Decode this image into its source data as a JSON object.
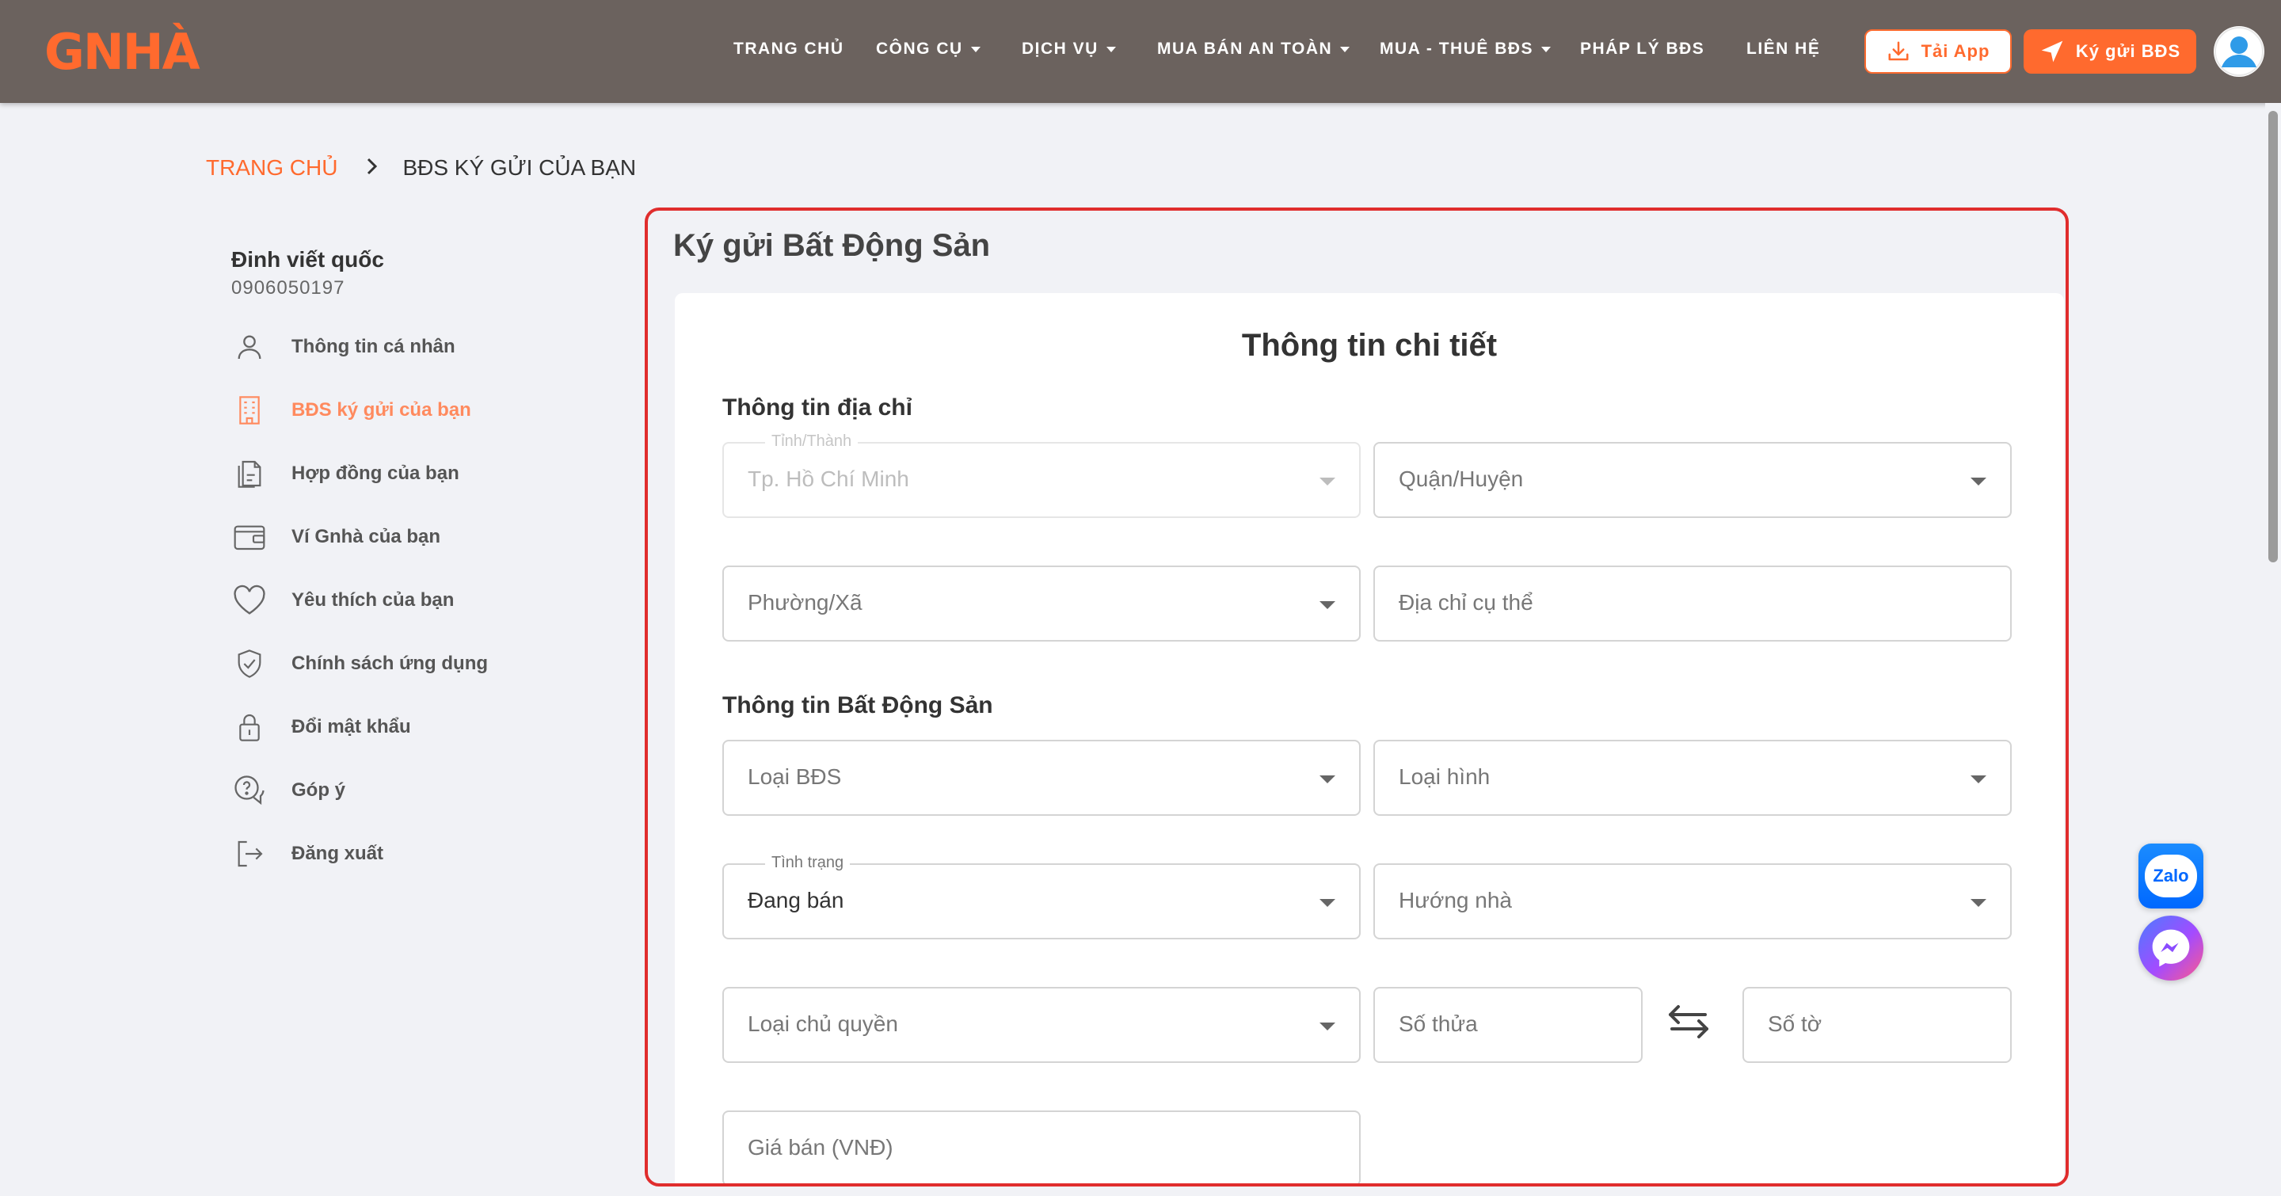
{
  "header": {
    "logo_text": "GNHÀ",
    "nav": [
      {
        "label": "TRANG CHỦ",
        "dropdown": false
      },
      {
        "label": "CÔNG CỤ",
        "dropdown": true
      },
      {
        "label": "DỊCH VỤ",
        "dropdown": true
      },
      {
        "label": "MUA BÁN AN TOÀN",
        "dropdown": true
      },
      {
        "label": "MUA - THUÊ BĐS",
        "dropdown": true
      },
      {
        "label": "PHÁP LÝ BĐS",
        "dropdown": false
      },
      {
        "label": "LIÊN HỆ",
        "dropdown": false
      }
    ],
    "app_button": "Tải App",
    "consign_button": "Ký gửi BĐS"
  },
  "breadcrumb": {
    "home": "TRANG CHỦ",
    "current": "BĐS KÝ GỬI CỦA BẠN"
  },
  "user": {
    "name": "Đinh viết quốc",
    "phone": "0906050197"
  },
  "sidebar": {
    "items": [
      {
        "label": "Thông tin cá nhân",
        "icon": "user-icon",
        "active": false
      },
      {
        "label": "BĐS ký gửi của bạn",
        "icon": "building-icon",
        "active": true
      },
      {
        "label": "Hợp đồng của bạn",
        "icon": "contract-icon",
        "active": false
      },
      {
        "label": "Ví Gnhà của bạn",
        "icon": "wallet-icon",
        "active": false
      },
      {
        "label": "Yêu thích của bạn",
        "icon": "heart-icon",
        "active": false
      },
      {
        "label": "Chính sách ứng dụng",
        "icon": "shield-icon",
        "active": false
      },
      {
        "label": "Đổi mật khẩu",
        "icon": "lock-icon",
        "active": false
      },
      {
        "label": "Góp ý",
        "icon": "feedback-icon",
        "active": false
      },
      {
        "label": "Đăng xuất",
        "icon": "logout-icon",
        "active": false
      }
    ]
  },
  "main": {
    "panel_title": "Ký gửi Bất Động Sản",
    "card_title": "Thông tin chi tiết",
    "address_section": "Thông tin địa chỉ",
    "property_section": "Thông tin Bất Động Sản",
    "fields": {
      "province": {
        "label": "Tỉnh/Thành",
        "value": "Tp. Hồ Chí Minh"
      },
      "district": {
        "placeholder": "Quận/Huyện"
      },
      "ward": {
        "placeholder": "Phường/Xã"
      },
      "address": {
        "placeholder": "Địa chỉ cụ thể"
      },
      "property_type": {
        "placeholder": "Loại BĐS"
      },
      "category": {
        "placeholder": "Loại hình"
      },
      "status": {
        "label": "Tình trạng",
        "value": "Đang bán"
      },
      "direction": {
        "placeholder": "Hướng nhà"
      },
      "ownership": {
        "placeholder": "Loại chủ quyền"
      },
      "parcel_no": {
        "placeholder": "Số thửa"
      },
      "sheet_no": {
        "placeholder": "Số tờ"
      },
      "price": {
        "placeholder": "Giá bán (VNĐ)"
      }
    }
  },
  "floating": {
    "zalo": "Zalo"
  },
  "colors": {
    "header_bg": "#6b625e",
    "accent": "#ff6a2e",
    "panel_border": "#e02d2d"
  }
}
